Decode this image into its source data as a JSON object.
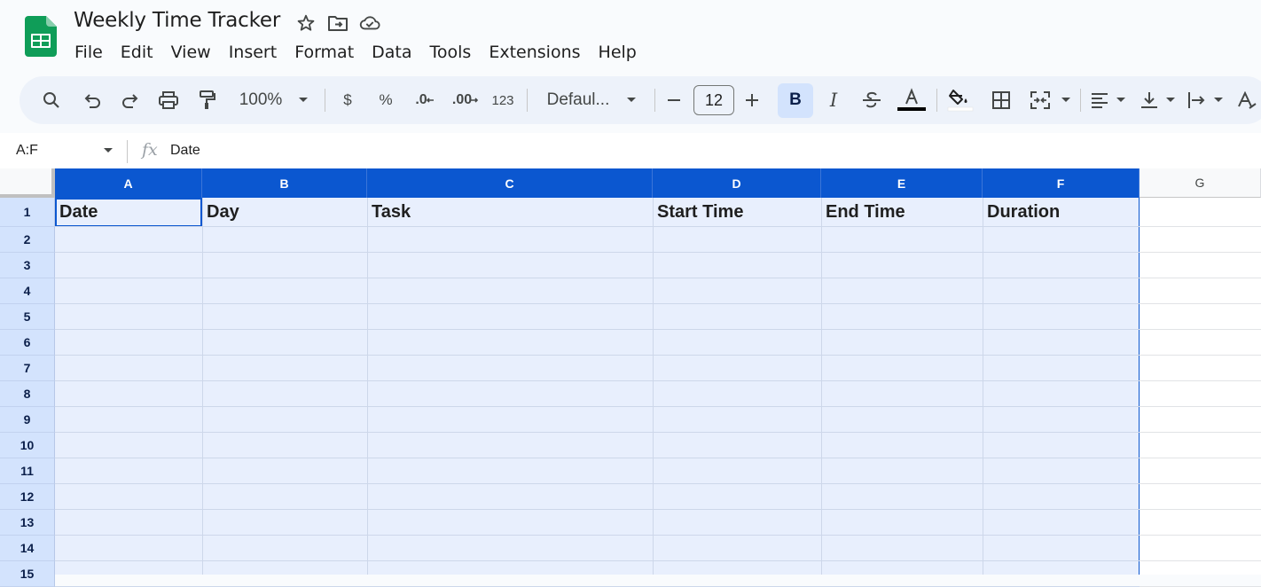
{
  "document": {
    "title": "Weekly Time Tracker"
  },
  "menu": [
    "File",
    "Edit",
    "View",
    "Insert",
    "Format",
    "Data",
    "Tools",
    "Extensions",
    "Help"
  ],
  "toolbar": {
    "zoom": "100%",
    "currency": "$",
    "percent": "%",
    "decrease_decimal": ".0",
    "increase_decimal": ".00",
    "number_format": "123",
    "font": "Defaul...",
    "font_size": "12",
    "bold": "B",
    "italic": "I"
  },
  "formula_bar": {
    "name_box": "A:F",
    "fx": "fx",
    "content": "Date"
  },
  "columns": [
    "A",
    "B",
    "C",
    "D",
    "E",
    "F",
    "G"
  ],
  "rows": [
    "1",
    "2",
    "3",
    "4",
    "5",
    "6",
    "7",
    "8",
    "9",
    "10",
    "11",
    "12",
    "13",
    "14",
    "15"
  ],
  "header_row": [
    "Date",
    "Day",
    "Task",
    "Start Time",
    "End Time",
    "Duration"
  ],
  "colors": {
    "selection_header": "#0b57d0",
    "selection_fill": "#e8effd",
    "row_header_selected": "#d3e3fd",
    "sheets_green": "#0f9d58"
  }
}
